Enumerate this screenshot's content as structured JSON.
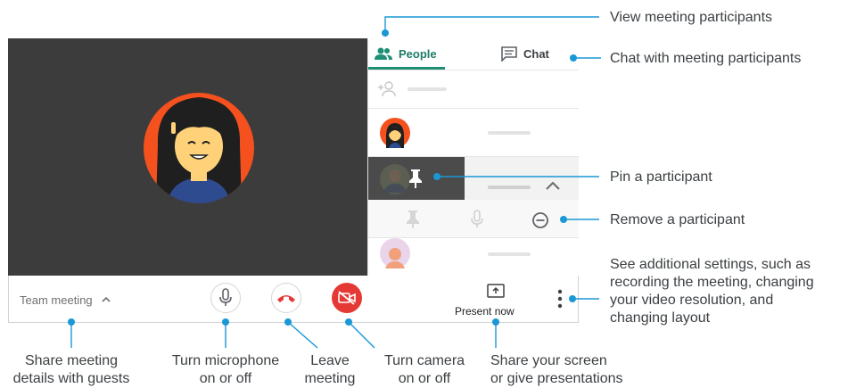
{
  "panel": {
    "tabs": [
      {
        "label": "People",
        "icon": "people-icon",
        "active": true
      },
      {
        "label": "Chat",
        "icon": "chat-icon",
        "active": false
      }
    ]
  },
  "toolbar": {
    "meeting_label": "Team meeting",
    "present_label": "Present now"
  },
  "callouts": {
    "view_participants": "View meeting participants",
    "chat_participants": "Chat with meeting participants",
    "pin_participant": "Pin a participant",
    "remove_participant": "Remove a participant",
    "more_settings": [
      "See additional settings, such as",
      "recording the meeting, changing",
      "your video resolution, and",
      "changing layout"
    ],
    "share_details": [
      "Share meeting",
      "details with guests"
    ],
    "microphone": [
      "Turn microphone",
      "on or off"
    ],
    "leave": [
      "Leave",
      "meeting"
    ],
    "camera": [
      "Turn camera",
      "on or off"
    ],
    "share_screen": [
      "Share your screen",
      "or give presentations"
    ]
  },
  "colors": {
    "accent_teal": "#1e8e75",
    "callout_dot": "#1a97d5",
    "leave_red": "#e53935",
    "stage_bg": "#3c3c3c",
    "avatar_orange": "#f4511e"
  }
}
